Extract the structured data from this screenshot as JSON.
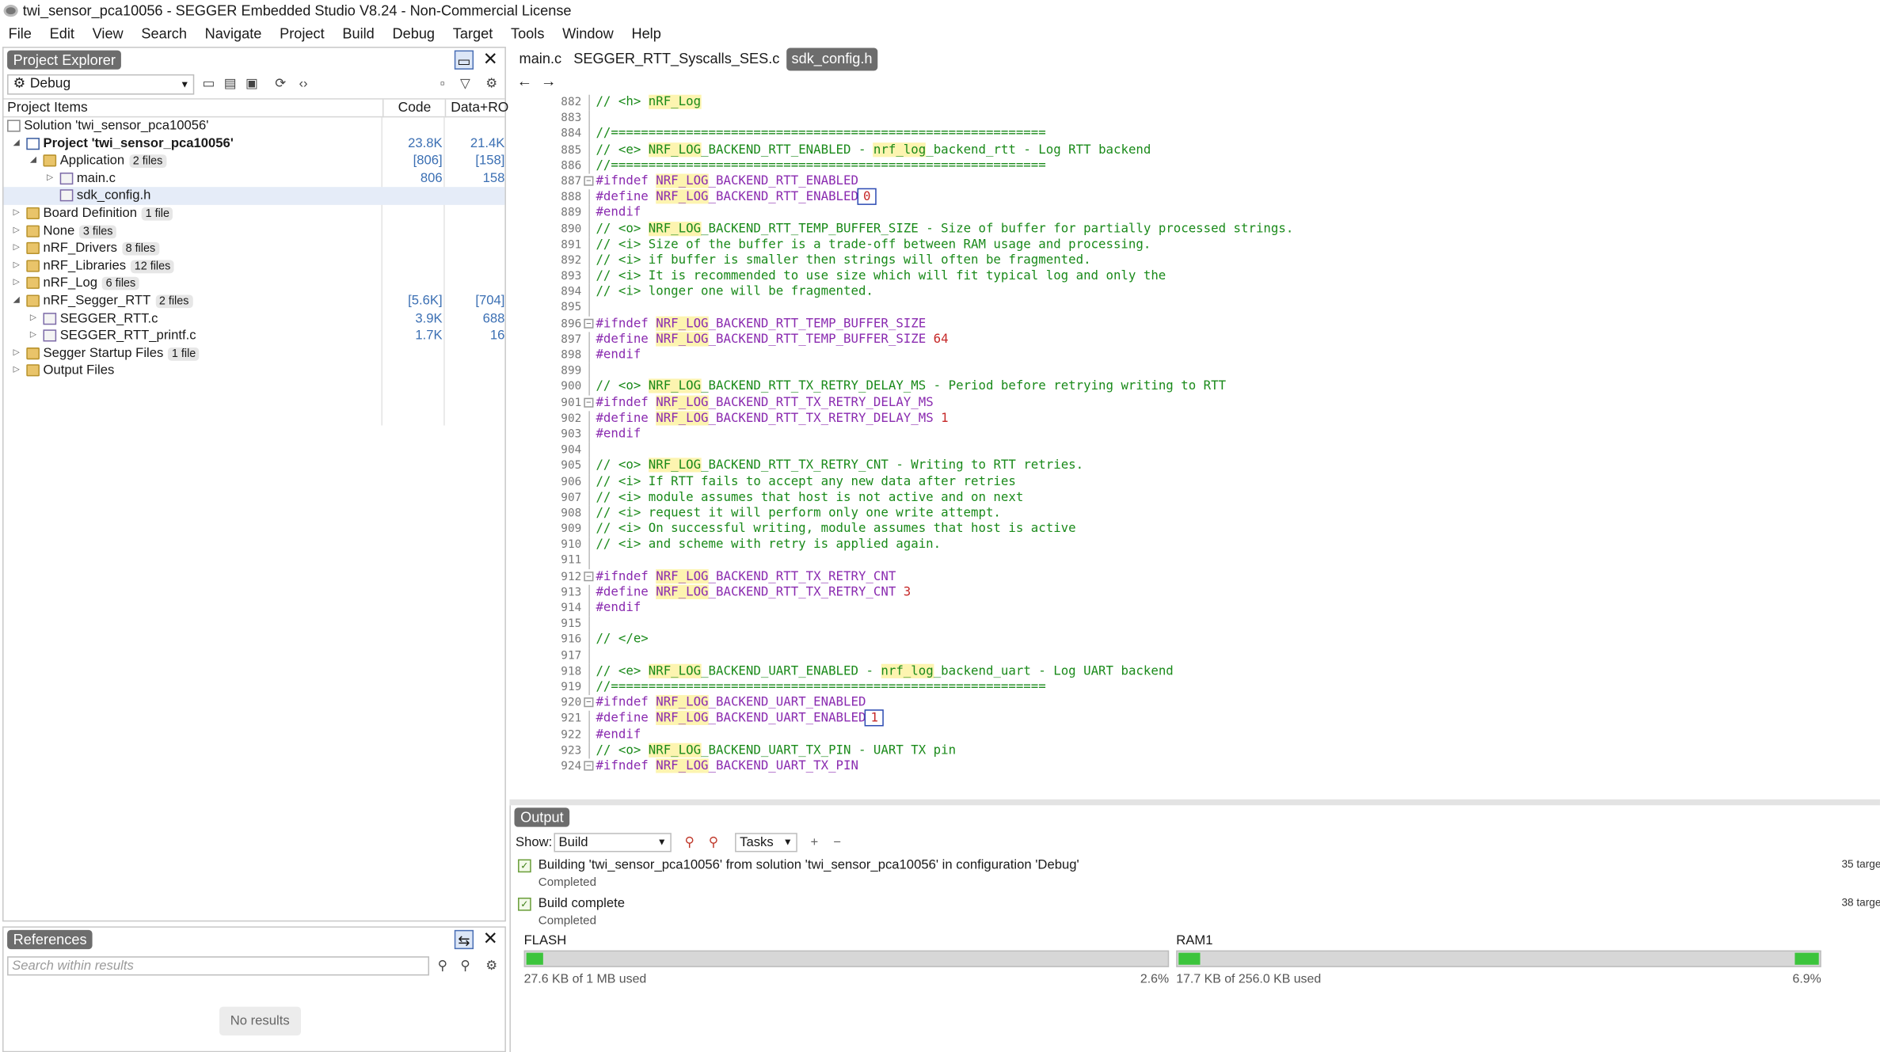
{
  "window_title": "twi_sensor_pca10056 - SEGGER Embedded Studio V8.24 - Non-Commercial License",
  "menu": [
    "File",
    "Edit",
    "View",
    "Search",
    "Navigate",
    "Project",
    "Build",
    "Debug",
    "Target",
    "Tools",
    "Window",
    "Help"
  ],
  "project_explorer": {
    "title": "Project Explorer",
    "config": "Debug",
    "columns": {
      "items": "Project Items",
      "code": "Code",
      "data": "Data+RO"
    },
    "tree": [
      {
        "label": "Solution 'twi_sensor_pca10056'",
        "level": 0,
        "icon": "solution-icon",
        "bold": false,
        "expander": "",
        "badge": "",
        "code": "",
        "data": ""
      },
      {
        "label": "Project 'twi_sensor_pca10056'",
        "level": 1,
        "icon": "project-icon",
        "bold": true,
        "expander": "◢",
        "badge": "",
        "code": "23.8K",
        "data": "21.4K"
      },
      {
        "label": "Application",
        "level": 2,
        "icon": "folder-icon",
        "bold": false,
        "expander": "◢",
        "badge": "2 files",
        "code": "[806]",
        "data": "[158]"
      },
      {
        "label": "main.c",
        "level": 3,
        "icon": "c-file-icon",
        "bold": false,
        "expander": "▷",
        "badge": "",
        "code": "806",
        "data": "158"
      },
      {
        "label": "sdk_config.h",
        "level": 3,
        "icon": "h-file-icon",
        "bold": false,
        "expander": "",
        "badge": "",
        "code": "",
        "data": "",
        "selected": true
      },
      {
        "label": "Board Definition",
        "level": 1,
        "icon": "folder-icon",
        "bold": false,
        "expander": "▷",
        "badge": "1 file",
        "code": "",
        "data": ""
      },
      {
        "label": "None",
        "level": 1,
        "icon": "folder-icon",
        "bold": false,
        "expander": "▷",
        "badge": "3 files",
        "code": "",
        "data": ""
      },
      {
        "label": "nRF_Drivers",
        "level": 1,
        "icon": "folder-icon",
        "bold": false,
        "expander": "▷",
        "badge": "8 files",
        "code": "",
        "data": ""
      },
      {
        "label": "nRF_Libraries",
        "level": 1,
        "icon": "folder-icon",
        "bold": false,
        "expander": "▷",
        "badge": "12 files",
        "code": "",
        "data": ""
      },
      {
        "label": "nRF_Log",
        "level": 1,
        "icon": "folder-icon",
        "bold": false,
        "expander": "▷",
        "badge": "6 files",
        "code": "",
        "data": ""
      },
      {
        "label": "nRF_Segger_RTT",
        "level": 1,
        "icon": "folder-icon",
        "bold": false,
        "expander": "◢",
        "badge": "2 files",
        "code": "[5.6K]",
        "data": "[704]"
      },
      {
        "label": "SEGGER_RTT.c",
        "level": 2,
        "icon": "c-file-icon",
        "bold": false,
        "expander": "▷",
        "badge": "",
        "code": "3.9K",
        "data": "688"
      },
      {
        "label": "SEGGER_RTT_printf.c",
        "level": 2,
        "icon": "c-file-icon",
        "bold": false,
        "expander": "▷",
        "badge": "",
        "code": "1.7K",
        "data": "16"
      },
      {
        "label": "Segger Startup Files",
        "level": 1,
        "icon": "folder-icon",
        "bold": false,
        "expander": "▷",
        "badge": "1 file",
        "code": "",
        "data": ""
      },
      {
        "label": "Output Files",
        "level": 1,
        "icon": "folder-icon",
        "bold": false,
        "expander": "▷",
        "badge": "",
        "code": "",
        "data": ""
      }
    ]
  },
  "references": {
    "title": "References",
    "search_placeholder": "Search within results",
    "empty": "No results"
  },
  "editor": {
    "tabs": [
      {
        "label": "main.c",
        "active": false
      },
      {
        "label": "SEGGER_RTT_Syscalls_SES.c",
        "active": false
      },
      {
        "label": "sdk_config.h",
        "active": true
      }
    ],
    "lines": [
      {
        "n": "882",
        "fold": "",
        "segs": [
          [
            "cm",
            "// <h> "
          ],
          [
            "cmhl",
            "nRF_Log"
          ]
        ]
      },
      {
        "n": "883",
        "fold": "",
        "segs": []
      },
      {
        "n": "884",
        "fold": "",
        "segs": [
          [
            "cm",
            "//=========================================================="
          ]
        ]
      },
      {
        "n": "885",
        "fold": "",
        "segs": [
          [
            "cm",
            "// <e> "
          ],
          [
            "cmhl",
            "NRF_LOG"
          ],
          [
            "cm",
            "_BACKEND_RTT_ENABLED - "
          ],
          [
            "cmhl",
            "nrf_log"
          ],
          [
            "cm",
            "_backend_rtt - Log RTT backend"
          ]
        ]
      },
      {
        "n": "886",
        "fold": "",
        "segs": [
          [
            "cm",
            "//=========================================================="
          ]
        ]
      },
      {
        "n": "887",
        "fold": "⊟",
        "segs": [
          [
            "pp",
            "#ifndef "
          ],
          [
            "machl",
            "NRF_LOG"
          ],
          [
            "mac",
            "_BACKEND_RTT_ENABLED"
          ]
        ]
      },
      {
        "n": "888",
        "fold": "",
        "segs": [
          [
            "pp",
            "#define "
          ],
          [
            "machl",
            "NRF_LOG"
          ],
          [
            "mac",
            "_BACKEND_RTT_ENABLED"
          ],
          [
            "nmbox",
            "0"
          ]
        ]
      },
      {
        "n": "889",
        "fold": "",
        "segs": [
          [
            "pp",
            "#endif"
          ]
        ]
      },
      {
        "n": "890",
        "fold": "",
        "segs": [
          [
            "cm",
            "// <o> "
          ],
          [
            "cmhl",
            "NRF_LOG"
          ],
          [
            "cm",
            "_BACKEND_RTT_TEMP_BUFFER_SIZE - Size of buffer for partially processed strings."
          ]
        ]
      },
      {
        "n": "891",
        "fold": "",
        "segs": [
          [
            "cm",
            "// <i> Size of the buffer is a trade-off between RAM usage and processing."
          ]
        ]
      },
      {
        "n": "892",
        "fold": "",
        "segs": [
          [
            "cm",
            "// <i> if buffer is smaller then strings will often be fragmented."
          ]
        ]
      },
      {
        "n": "893",
        "fold": "",
        "segs": [
          [
            "cm",
            "// <i> It is recommended to use size which will fit typical log and only the"
          ]
        ]
      },
      {
        "n": "894",
        "fold": "",
        "segs": [
          [
            "cm",
            "// <i> longer one will be fragmented."
          ]
        ]
      },
      {
        "n": "895",
        "fold": "",
        "segs": []
      },
      {
        "n": "896",
        "fold": "⊟",
        "segs": [
          [
            "pp",
            "#ifndef "
          ],
          [
            "machl",
            "NRF_LOG"
          ],
          [
            "mac",
            "_BACKEND_RTT_TEMP_BUFFER_SIZE"
          ]
        ]
      },
      {
        "n": "897",
        "fold": "",
        "segs": [
          [
            "pp",
            "#define "
          ],
          [
            "machl",
            "NRF_LOG"
          ],
          [
            "mac",
            "_BACKEND_RTT_TEMP_BUFFER_SIZE "
          ],
          [
            "nm",
            "64"
          ]
        ]
      },
      {
        "n": "898",
        "fold": "",
        "segs": [
          [
            "pp",
            "#endif"
          ]
        ]
      },
      {
        "n": "899",
        "fold": "",
        "segs": []
      },
      {
        "n": "900",
        "fold": "",
        "segs": [
          [
            "cm",
            "// <o> "
          ],
          [
            "cmhl",
            "NRF_LOG"
          ],
          [
            "cm",
            "_BACKEND_RTT_TX_RETRY_DELAY_MS - Period before retrying writing to RTT"
          ]
        ]
      },
      {
        "n": "901",
        "fold": "⊟",
        "segs": [
          [
            "pp",
            "#ifndef "
          ],
          [
            "machl",
            "NRF_LOG"
          ],
          [
            "mac",
            "_BACKEND_RTT_TX_RETRY_DELAY_MS"
          ]
        ]
      },
      {
        "n": "902",
        "fold": "",
        "segs": [
          [
            "pp",
            "#define "
          ],
          [
            "machl",
            "NRF_LOG"
          ],
          [
            "mac",
            "_BACKEND_RTT_TX_RETRY_DELAY_MS "
          ],
          [
            "nm",
            "1"
          ]
        ]
      },
      {
        "n": "903",
        "fold": "",
        "segs": [
          [
            "pp",
            "#endif"
          ]
        ]
      },
      {
        "n": "904",
        "fold": "",
        "segs": []
      },
      {
        "n": "905",
        "fold": "",
        "segs": [
          [
            "cm",
            "// <o> "
          ],
          [
            "cmhl",
            "NRF_LOG"
          ],
          [
            "cm",
            "_BACKEND_RTT_TX_RETRY_CNT - Writing to RTT retries."
          ]
        ]
      },
      {
        "n": "906",
        "fold": "",
        "segs": [
          [
            "cm",
            "// <i> If RTT fails to accept any new data after retries"
          ]
        ]
      },
      {
        "n": "907",
        "fold": "",
        "segs": [
          [
            "cm",
            "// <i> module assumes that host is not active and on next"
          ]
        ]
      },
      {
        "n": "908",
        "fold": "",
        "segs": [
          [
            "cm",
            "// <i> request it will perform only one write attempt."
          ]
        ]
      },
      {
        "n": "909",
        "fold": "",
        "segs": [
          [
            "cm",
            "// <i> On successful writing, module assumes that host is active"
          ]
        ]
      },
      {
        "n": "910",
        "fold": "",
        "segs": [
          [
            "cm",
            "// <i> and scheme with retry is applied again."
          ]
        ]
      },
      {
        "n": "911",
        "fold": "",
        "segs": []
      },
      {
        "n": "912",
        "fold": "⊟",
        "segs": [
          [
            "pp",
            "#ifndef "
          ],
          [
            "machl",
            "NRF_LOG"
          ],
          [
            "mac",
            "_BACKEND_RTT_TX_RETRY_CNT"
          ]
        ]
      },
      {
        "n": "913",
        "fold": "",
        "segs": [
          [
            "pp",
            "#define "
          ],
          [
            "machl",
            "NRF_LOG"
          ],
          [
            "mac",
            "_BACKEND_RTT_TX_RETRY_CNT "
          ],
          [
            "nm",
            "3"
          ]
        ]
      },
      {
        "n": "914",
        "fold": "",
        "segs": [
          [
            "pp",
            "#endif"
          ]
        ]
      },
      {
        "n": "915",
        "fold": "",
        "segs": []
      },
      {
        "n": "916",
        "fold": "",
        "segs": [
          [
            "cm",
            "// </e>"
          ]
        ]
      },
      {
        "n": "917",
        "fold": "",
        "segs": []
      },
      {
        "n": "918",
        "fold": "",
        "segs": [
          [
            "cm",
            "// <e> "
          ],
          [
            "cmhl",
            "NRF_LOG"
          ],
          [
            "cm",
            "_BACKEND_UART_ENABLED - "
          ],
          [
            "cmhl",
            "nrf_log"
          ],
          [
            "cm",
            "_backend_uart - Log UART backend"
          ]
        ]
      },
      {
        "n": "919",
        "fold": "",
        "segs": [
          [
            "cm",
            "//=========================================================="
          ]
        ]
      },
      {
        "n": "920",
        "fold": "⊟",
        "segs": [
          [
            "pp",
            "#ifndef "
          ],
          [
            "machl",
            "NRF_LOG"
          ],
          [
            "mac",
            "_BACKEND_UART_ENABLED"
          ]
        ]
      },
      {
        "n": "921",
        "fold": "",
        "segs": [
          [
            "pp",
            "#define "
          ],
          [
            "machl",
            "NRF_LOG"
          ],
          [
            "mac",
            "_BACKEND_UART_ENABLED"
          ],
          [
            "nmbox",
            "1"
          ]
        ]
      },
      {
        "n": "922",
        "fold": "",
        "segs": [
          [
            "pp",
            "#endif"
          ]
        ]
      },
      {
        "n": "923",
        "fold": "",
        "segs": [
          [
            "cm",
            "// <o> "
          ],
          [
            "cmhl",
            "NRF_LOG"
          ],
          [
            "cm",
            "_BACKEND_UART_TX_PIN - UART TX pin"
          ]
        ]
      },
      {
        "n": "924",
        "fold": "⊟",
        "segs": [
          [
            "pp",
            "#ifndef "
          ],
          [
            "machl",
            "NRF_LOG"
          ],
          [
            "mac",
            "_BACKEND_UART_TX_PIN"
          ]
        ]
      }
    ]
  },
  "output": {
    "title": "Output",
    "show_label": "Show:",
    "show_value": "Build",
    "tasks_value": "Tasks",
    "messages": [
      {
        "text": "Building 'twi_sensor_pca10056' from solution 'twi_sensor_pca10056' in configuration 'Debug'",
        "status": "Completed",
        "right": "35 targe"
      },
      {
        "text": "Build complete",
        "status": "Completed",
        "right": "38 targe"
      }
    ],
    "memory": [
      {
        "name": "FLASH",
        "used": "27.6 KB of 1 MB used",
        "percent": "2.6%",
        "fraction": 0.026
      },
      {
        "name": "RAM1",
        "used": "17.7 KB of 256.0 KB used",
        "percent": "6.9%",
        "fraction": 0.069
      }
    ]
  }
}
